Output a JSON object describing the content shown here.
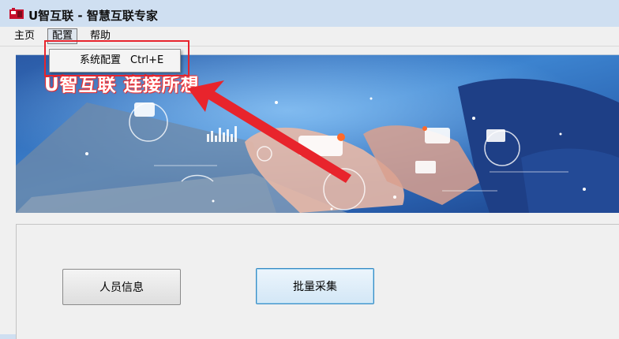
{
  "window": {
    "title": "U智互联 - 智慧互联专家"
  },
  "menubar": {
    "items": [
      {
        "label": "主页"
      },
      {
        "label": "配置"
      },
      {
        "label": "帮助"
      }
    ]
  },
  "config_menu": {
    "items": [
      {
        "label": "系统配置",
        "shortcut": "Ctrl+E"
      }
    ]
  },
  "banner": {
    "slogan": "U智互联  连接所想"
  },
  "buttons": {
    "personnel_info": "人员信息",
    "batch_collect": "批量采集"
  },
  "colors": {
    "annotation": "#e8242c",
    "title_bar": "#cfdff1",
    "focus_border": "#3a8cc4"
  }
}
